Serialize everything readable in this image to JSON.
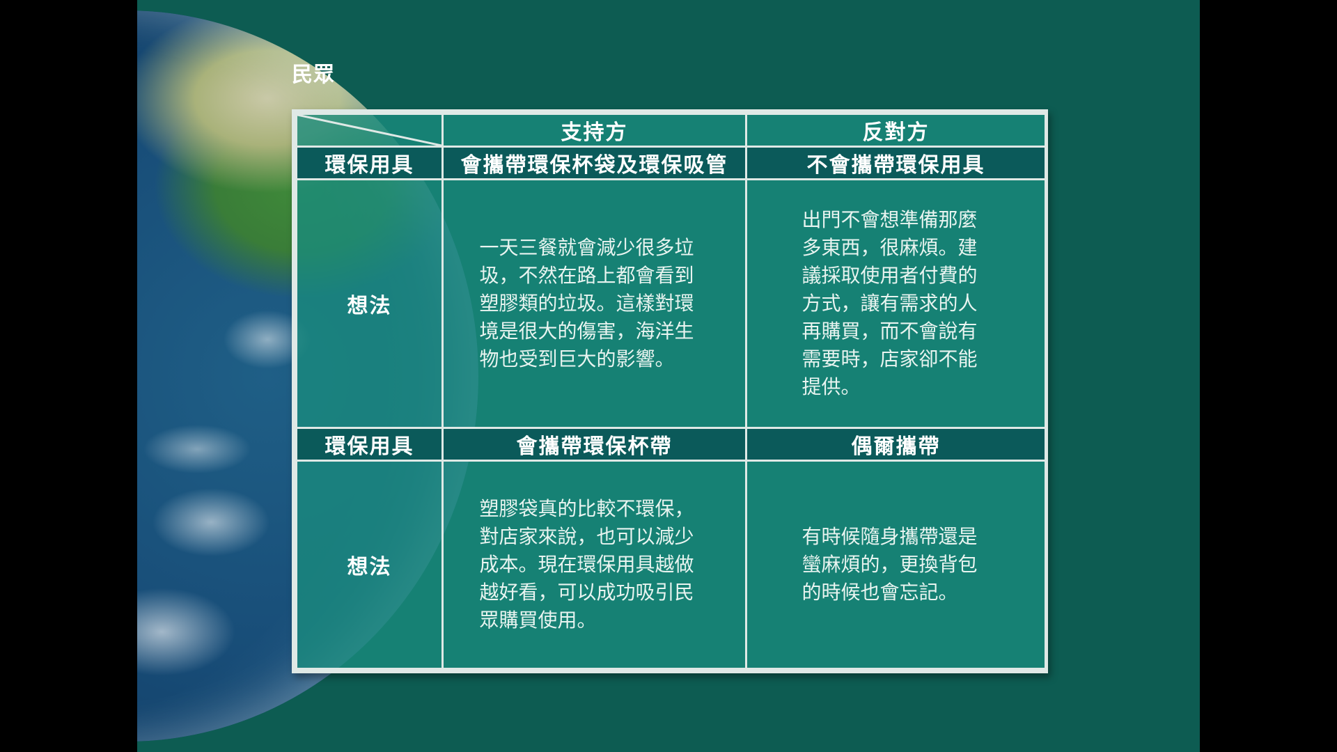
{
  "slide": {
    "title": "民眾"
  },
  "table": {
    "header": {
      "support": "支持方",
      "oppose": "反對方"
    },
    "rows": [
      {
        "category": "環保用具",
        "support_stance": "會攜帶環保杯袋及環保吸管",
        "oppose_stance": "不會攜帶環保用具",
        "idea_label": "想法",
        "support_text": "一天三餐就會減少很多垃\n圾，不然在路上都會看到\n塑膠類的垃圾。這樣對環\n境是很大的傷害，海洋生\n物也受到巨大的影響。",
        "oppose_text": "出門不會想準備那麼\n多東西，很麻煩。建\n議採取使用者付費的\n方式，讓有需求的人\n再購買，而不會說有\n需要時，店家卻不能\n提供。"
      },
      {
        "category": "環保用具",
        "support_stance": "會攜帶環保杯帶",
        "oppose_stance": "偶爾攜帶",
        "idea_label": "想法",
        "support_text": "塑膠袋真的比較不環保，\n對店家來說，也可以減少\n成本。現在環保用具越做\n越好看，可以成功吸引民\n眾購買使用。",
        "oppose_text": "有時候隨身攜帶還是\n蠻麻煩的，更換背包\n的時候也會忘記。"
      }
    ]
  },
  "colors": {
    "background": "#0d5c52",
    "table_fill": "#198c7d",
    "header_dark": "#0b5a5a",
    "border": "#dfe9e6"
  }
}
